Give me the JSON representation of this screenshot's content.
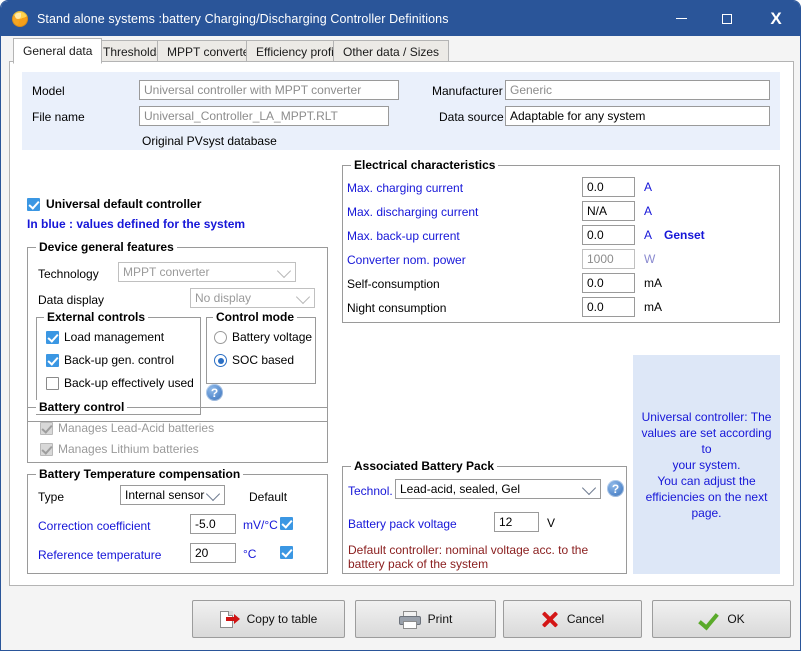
{
  "window": {
    "title": "Stand alone systems :battery Charging/Discharging Controller Definitions",
    "minimize_label": "─",
    "maximize_label": "□",
    "close_label": "X"
  },
  "tabs": [
    {
      "label": "General data",
      "active": true
    },
    {
      "label": "Thresholds",
      "active": false
    },
    {
      "label": "MPPT converter",
      "active": false
    },
    {
      "label": "Efficiency profile",
      "active": false
    },
    {
      "label": "Other data / Sizes",
      "active": false
    }
  ],
  "header_form": {
    "model_label": "Model",
    "model_value": "Universal controller with MPPT converter",
    "file_name_label": "File name",
    "file_name_value": "Universal_Controller_LA_MPPT.RLT",
    "database_note": "Original PVsyst database",
    "manufacturer_label": "Manufacturer",
    "manufacturer_value": "Generic",
    "data_source_label": "Data source",
    "data_source_value": "Adaptable for any system"
  },
  "universal_default": {
    "checkbox_label": "Universal default controller",
    "checked": true,
    "legend": "In blue : values defined for the system"
  },
  "device_general_features": {
    "title": "Device general features",
    "technology_label": "Technology",
    "technology_value": "MPPT converter",
    "data_display_label": "Data display",
    "data_display_value": "No display",
    "external_controls": {
      "title": "External controls",
      "items": [
        {
          "label": "Load management",
          "checked": true
        },
        {
          "label": "Back-up gen. control",
          "checked": true
        },
        {
          "label": "Back-up effectively used",
          "checked": false
        }
      ]
    },
    "control_mode": {
      "title": "Control mode",
      "options": [
        {
          "label": "Battery voltage",
          "selected": false
        },
        {
          "label": "SOC based",
          "selected": true
        }
      ]
    },
    "help_icon_label": "?"
  },
  "battery_control": {
    "title": "Battery control",
    "items": [
      {
        "label": "Manages Lead-Acid batteries",
        "checked": true,
        "disabled": true
      },
      {
        "label": "Manages Lithium batteries",
        "checked": true,
        "disabled": true
      }
    ]
  },
  "battery_temp_compensation": {
    "title": "Battery Temperature compensation",
    "type_label": "Type",
    "type_value": "Internal sensor",
    "default_label": "Default",
    "rows": [
      {
        "label": "Correction coefficient",
        "value": "-5.0",
        "unit": "mV/°C",
        "default_checked": true
      },
      {
        "label": "Reference temperature",
        "value": "20",
        "unit": "°C",
        "default_checked": true
      }
    ]
  },
  "electrical_characteristics": {
    "title": "Electrical characteristics",
    "rows": [
      {
        "label": "Max. charging current",
        "value": "0.0",
        "unit": "A",
        "label_blue": true,
        "disabled": false,
        "extra": ""
      },
      {
        "label": "Max. discharging current",
        "value": "N/A",
        "unit": "A",
        "label_blue": true,
        "disabled": false,
        "extra": ""
      },
      {
        "label": "Max. back-up current",
        "value": "0.0",
        "unit": "A",
        "label_blue": true,
        "disabled": false,
        "extra": "Genset"
      },
      {
        "label": "Converter nom. power",
        "value": "1000",
        "unit": "W",
        "label_blue": true,
        "disabled": true,
        "extra": ""
      },
      {
        "label": "Self-consumption",
        "value": "0.0",
        "unit": "mA",
        "label_blue": false,
        "disabled": false,
        "extra": ""
      },
      {
        "label": "Night consumption",
        "value": "0.0",
        "unit": "mA",
        "label_blue": false,
        "disabled": false,
        "extra": ""
      }
    ]
  },
  "associated_battery_pack": {
    "title": "Associated Battery Pack",
    "technol_label": "Technol.",
    "technol_value": "Lead-acid, sealed, Gel",
    "voltage_label": "Battery pack voltage",
    "voltage_value": "12",
    "voltage_unit": "V",
    "note_line1": "Default controller: nominal voltage acc. to the",
    "note_line2": "battery pack of the system",
    "help_icon_label": "?"
  },
  "info_panel": {
    "line1": "Universal controller: The",
    "line2": "values are set according to",
    "line3": "your system.",
    "line4": "You can adjust the",
    "line5": "efficiencies on the next",
    "line6": "page."
  },
  "buttons": {
    "copy_to_table": "Copy to table",
    "print": "Print",
    "cancel": "Cancel",
    "ok": "OK"
  },
  "colors": {
    "title_bar": "#2a5599",
    "blue_text": "#1616d8",
    "dark_red_note": "#8b2020",
    "info_panel_bg": "#dde7f7",
    "header_band_bg": "#eaf0fb"
  }
}
